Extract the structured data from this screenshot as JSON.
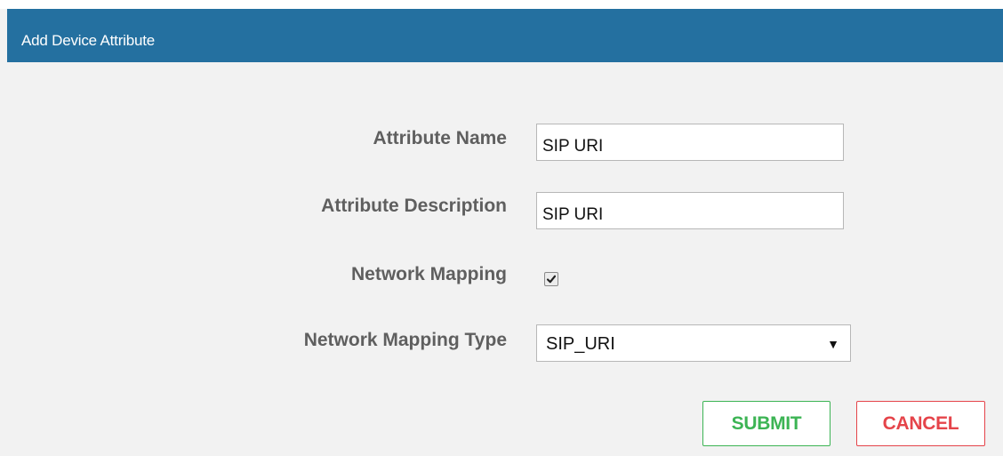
{
  "dialog": {
    "title": "Add Device Attribute"
  },
  "form": {
    "attribute_name": {
      "label": "Attribute Name",
      "value": "SIP URI"
    },
    "attribute_description": {
      "label": "Attribute Description",
      "value": "SIP URI"
    },
    "network_mapping": {
      "label": "Network Mapping",
      "checked": true
    },
    "network_mapping_type": {
      "label": "Network Mapping Type",
      "selected": "SIP_URI"
    }
  },
  "buttons": {
    "submit": "SUBMIT",
    "cancel": "CANCEL"
  },
  "colors": {
    "header": "#2470a0",
    "submit": "#3cb454",
    "cancel": "#e5444a"
  },
  "icons": {
    "checkbox": "checkmark-icon",
    "select": "dropdown-arrow-icon"
  }
}
